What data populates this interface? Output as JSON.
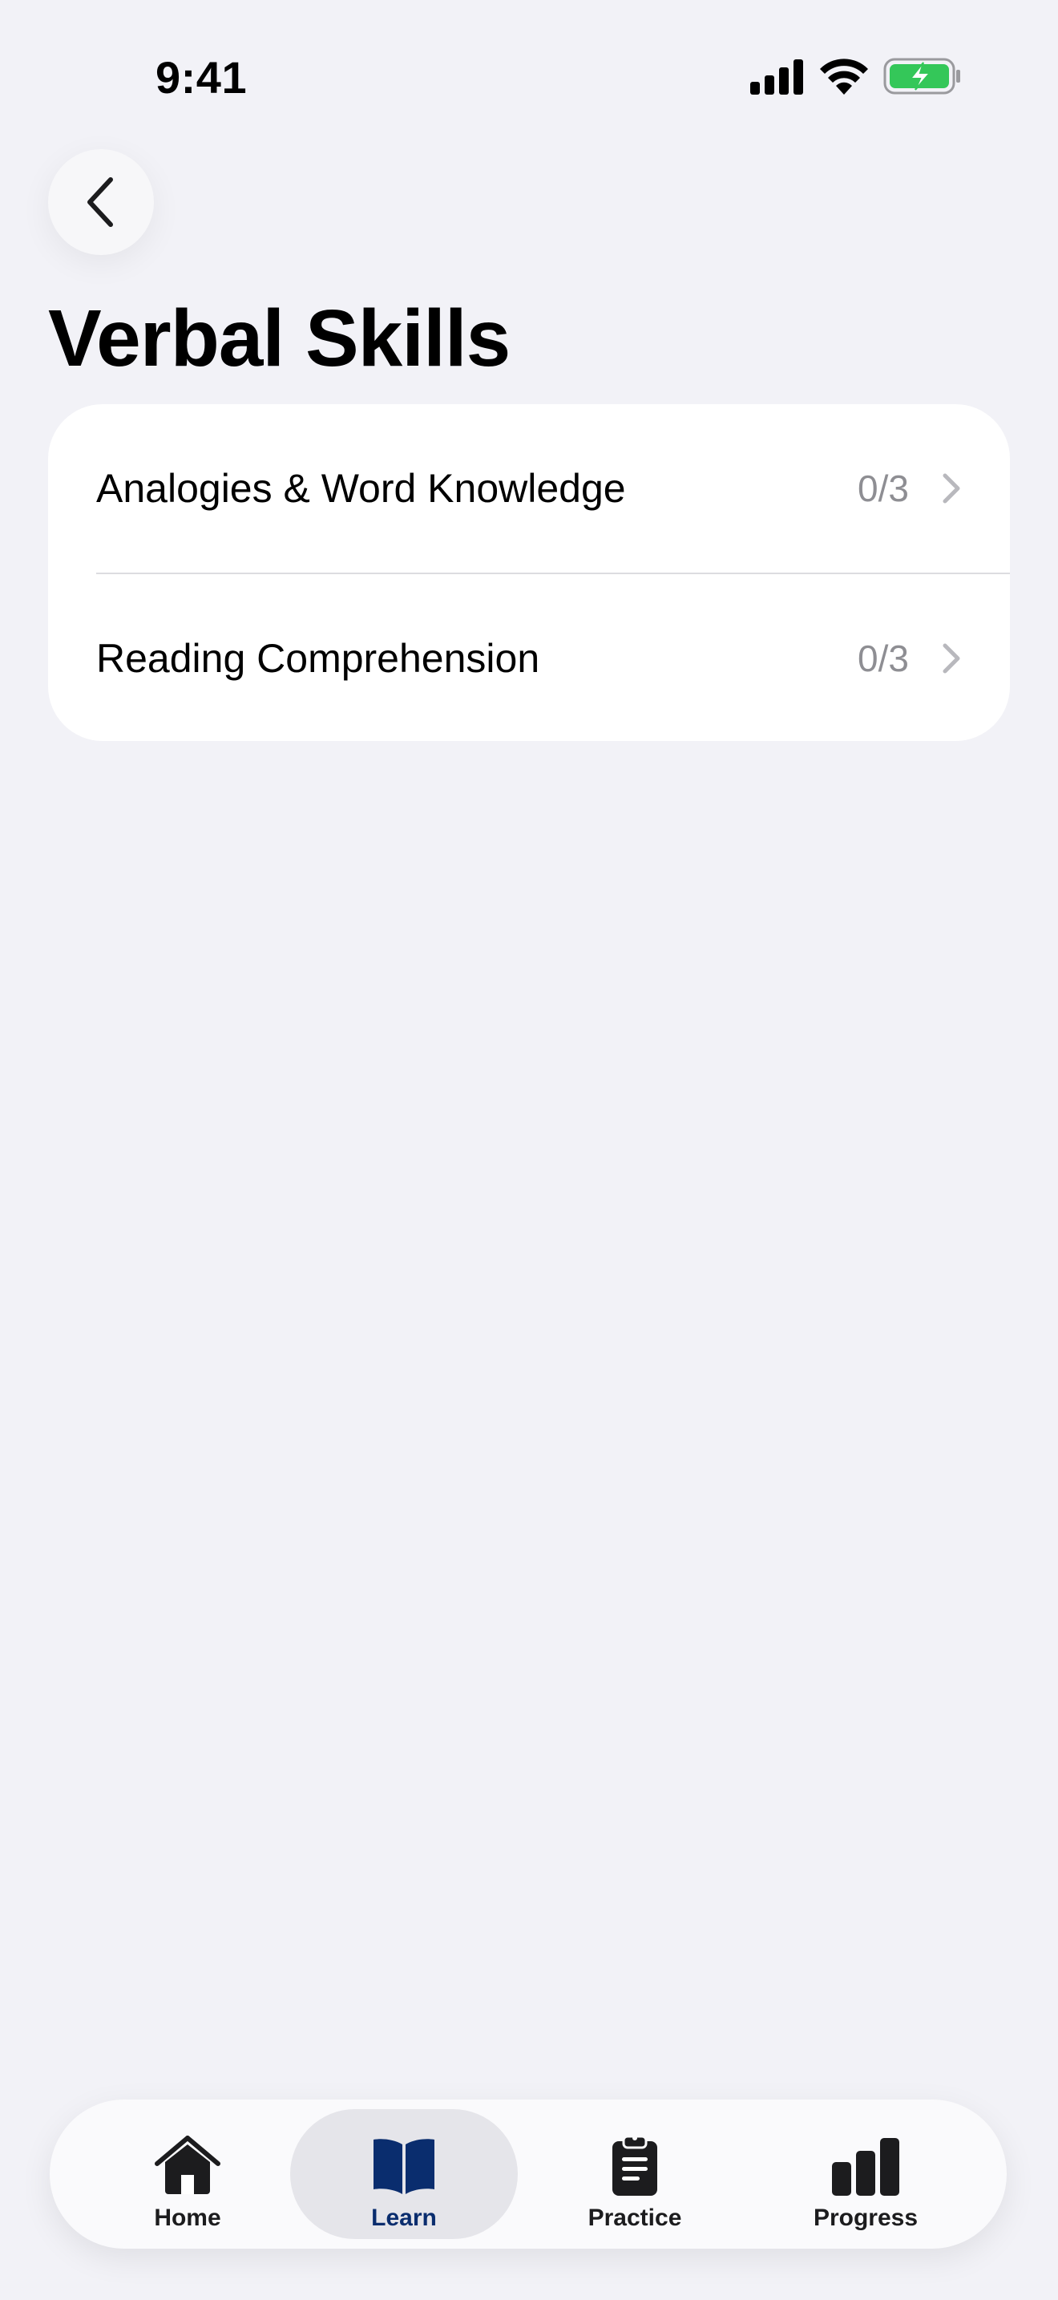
{
  "status_bar": {
    "time": "9:41"
  },
  "header": {
    "title": "Verbal Skills"
  },
  "list": {
    "items": [
      {
        "label": "Analogies & Word Knowledge",
        "progress": "0/3"
      },
      {
        "label": "Reading Comprehension",
        "progress": "0/3"
      }
    ]
  },
  "tab_bar": {
    "tabs": [
      {
        "label": "Home",
        "icon": "house-icon"
      },
      {
        "label": "Learn",
        "icon": "book-icon",
        "active": true
      },
      {
        "label": "Practice",
        "icon": "clipboard-icon"
      },
      {
        "label": "Progress",
        "icon": "bar-chart-icon"
      }
    ]
  },
  "colors": {
    "background": "#F2F2F7",
    "card": "#FFFFFF",
    "secondary_text": "#8E8E93",
    "accent": "#0A2D6E",
    "battery": "#34C759"
  }
}
